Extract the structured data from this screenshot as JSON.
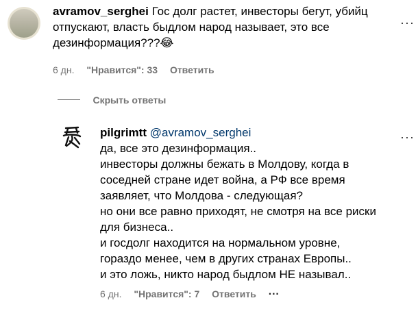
{
  "comment1": {
    "username": "avramov_serghei",
    "text_line1": "Гос долг растет, инвесторы бегут, убийц",
    "text_line2": "отпускают, власть быдлом народ называет, это все",
    "text_line3": "дезинформация???",
    "emoji": "😂",
    "time": "6 дн.",
    "likes": "\"Нравится\": 33",
    "reply": "Ответить",
    "more": "···"
  },
  "hide_replies": "Скрыть ответы",
  "reply1": {
    "username": "pilgrimtt",
    "mention": "@avramov_serghei",
    "lines": [
      "да, все это дезинформация..",
      "инвесторы должны бежать в Молдову, когда в",
      "соседней стране идет война, а РФ все время",
      "заявляет, что Молдова - следующая?",
      "но они все равно приходят, не смотря на все риски",
      "для бизнеса..",
      "и госдолг находится на нормальном уровне,",
      "гораздо менее, чем в других странах Европы..",
      "и это ложь, никто народ быдлом НЕ называл.."
    ],
    "time": "6 дн.",
    "likes": "\"Нравится\": 7",
    "reply": "Ответить",
    "more": "···"
  },
  "colors": {
    "meta": "#737373",
    "mention": "#00376b"
  }
}
